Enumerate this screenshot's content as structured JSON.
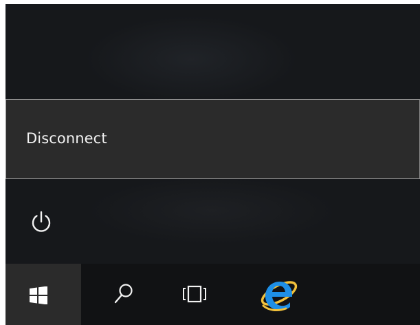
{
  "context_menu": {
    "items": [
      {
        "label": "Disconnect"
      }
    ]
  },
  "power": {
    "icon": "power-icon"
  },
  "taskbar": {
    "buttons": [
      {
        "icon": "windows-logo-icon"
      },
      {
        "icon": "search-icon"
      },
      {
        "icon": "task-view-icon"
      },
      {
        "icon": "internet-explorer-icon"
      }
    ]
  },
  "colors": {
    "panel_background": "#16181b",
    "menu_background": "#2b2b2b",
    "menu_border": "#8c8c8c",
    "taskbar_background": "#111214",
    "start_button_background": "#2b2b2b",
    "text": "#f2f2f2",
    "ie_blue": "#1e8fe6",
    "ie_ring": "#f2c13b"
  }
}
